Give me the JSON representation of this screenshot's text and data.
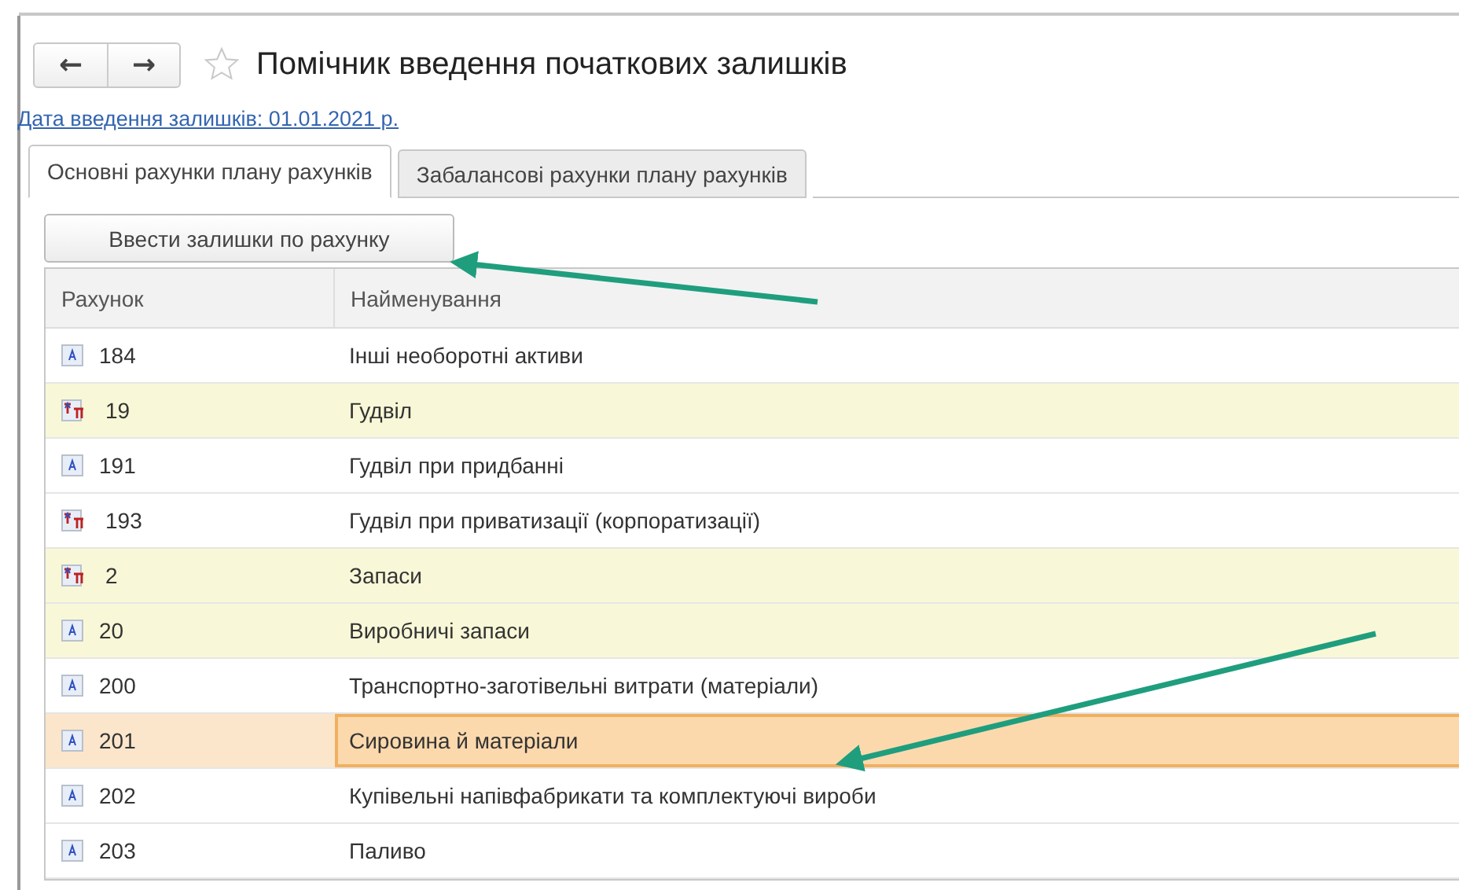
{
  "window": {
    "title": "Помічник введення початкових залишків",
    "back": "←",
    "forward": "→",
    "favorite": false
  },
  "date_link": "Дата введення залишків: 01.01.2021 р.",
  "tabs": [
    {
      "label": "Основні рахунки плану рахунків",
      "selected": true
    },
    {
      "label": "Забалансові рахунки плану рахунків",
      "selected": false
    }
  ],
  "enter_button": "Ввести залишки по рахунку",
  "table": {
    "columns": [
      "Рахунок",
      "Найменування"
    ],
    "rows": [
      {
        "kind": "account",
        "code": "184",
        "name": "Інші необоротні активи",
        "highlighted": false,
        "selected": false
      },
      {
        "kind": "group",
        "code": "19",
        "name": "Гудвіл",
        "highlighted": true,
        "selected": false
      },
      {
        "kind": "account",
        "code": "191",
        "name": "Гудвіл при придбанні",
        "highlighted": false,
        "selected": false
      },
      {
        "kind": "group",
        "code": "193",
        "name": "Гудвіл при приватизації (корпоратизації)",
        "highlighted": false,
        "selected": false
      },
      {
        "kind": "group",
        "code": "2",
        "name": "Запаси",
        "highlighted": true,
        "selected": false
      },
      {
        "kind": "account",
        "code": "20",
        "name": "Виробничі запаси",
        "highlighted": true,
        "selected": false
      },
      {
        "kind": "account",
        "code": "200",
        "name": "Транспортно-заготівельні витрати (матеріали)",
        "highlighted": false,
        "selected": false
      },
      {
        "kind": "account",
        "code": "201",
        "name": "Сировина й матеріали",
        "highlighted": false,
        "selected": true
      },
      {
        "kind": "account",
        "code": "202",
        "name": "Купівельні напівфабрикати та комплектуючі вироби",
        "highlighted": false,
        "selected": false
      },
      {
        "kind": "account",
        "code": "203",
        "name": "Паливо",
        "highlighted": false,
        "selected": false
      }
    ]
  }
}
